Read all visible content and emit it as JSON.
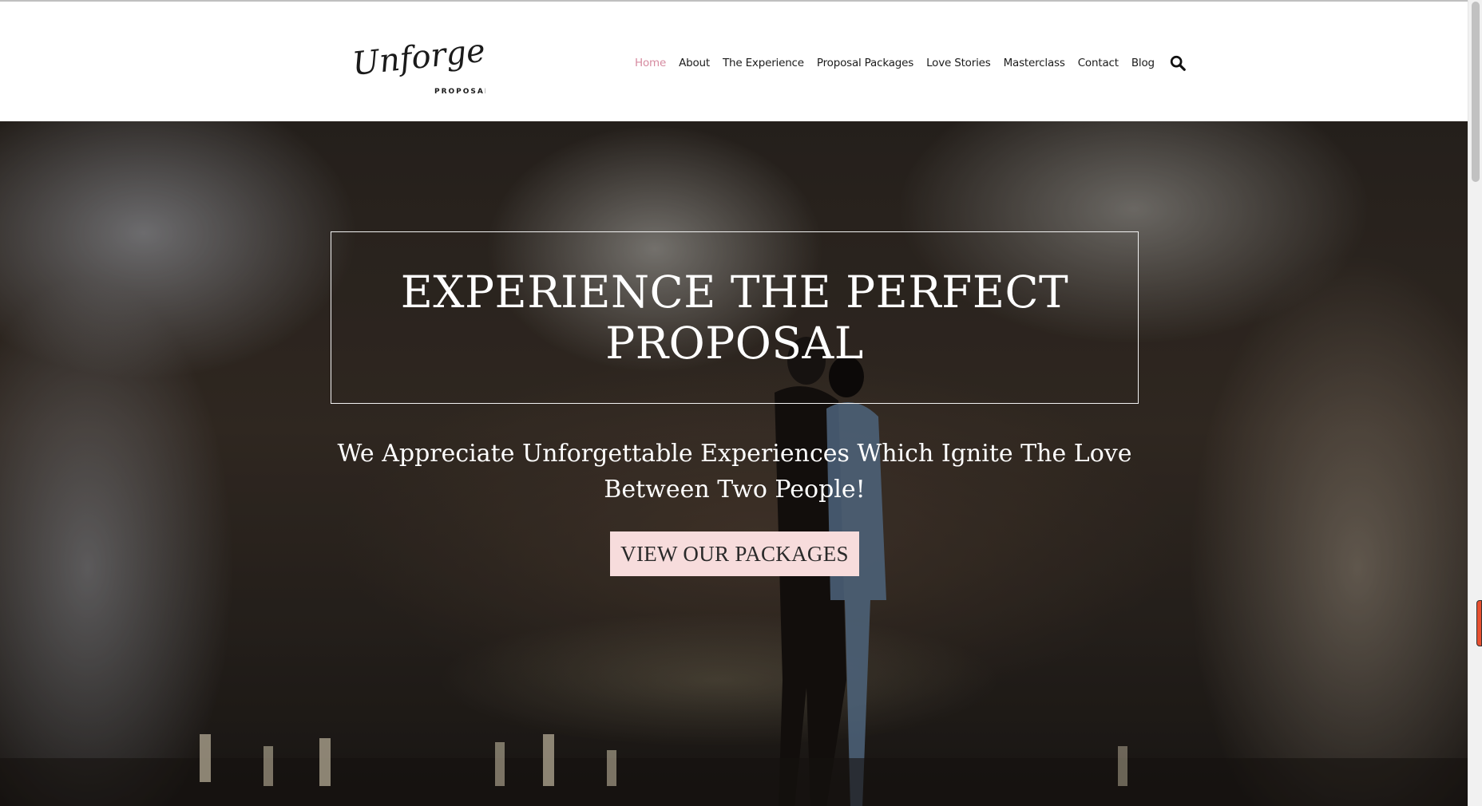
{
  "logo": {
    "script": "Unforgettable",
    "sub": "PROPOSALS"
  },
  "nav": {
    "items": [
      "Home",
      "About",
      "The Experience",
      "Proposal Packages",
      "Love Stories",
      "Masterclass",
      "Contact",
      "Blog"
    ],
    "active": "Home",
    "search_icon": "search-icon"
  },
  "hero": {
    "title": "EXPERIENCE THE PERFECT PROPOSAL",
    "subtitle": "We Appreciate Unforgettable Experiences Which Ignite The Love Between Two People!",
    "cta_label": "VIEW OUR PACKAGES"
  },
  "colors": {
    "active_nav": "#d68ba0",
    "cta_background": "#f7dcdc",
    "text_dark": "#1c1c1c"
  }
}
